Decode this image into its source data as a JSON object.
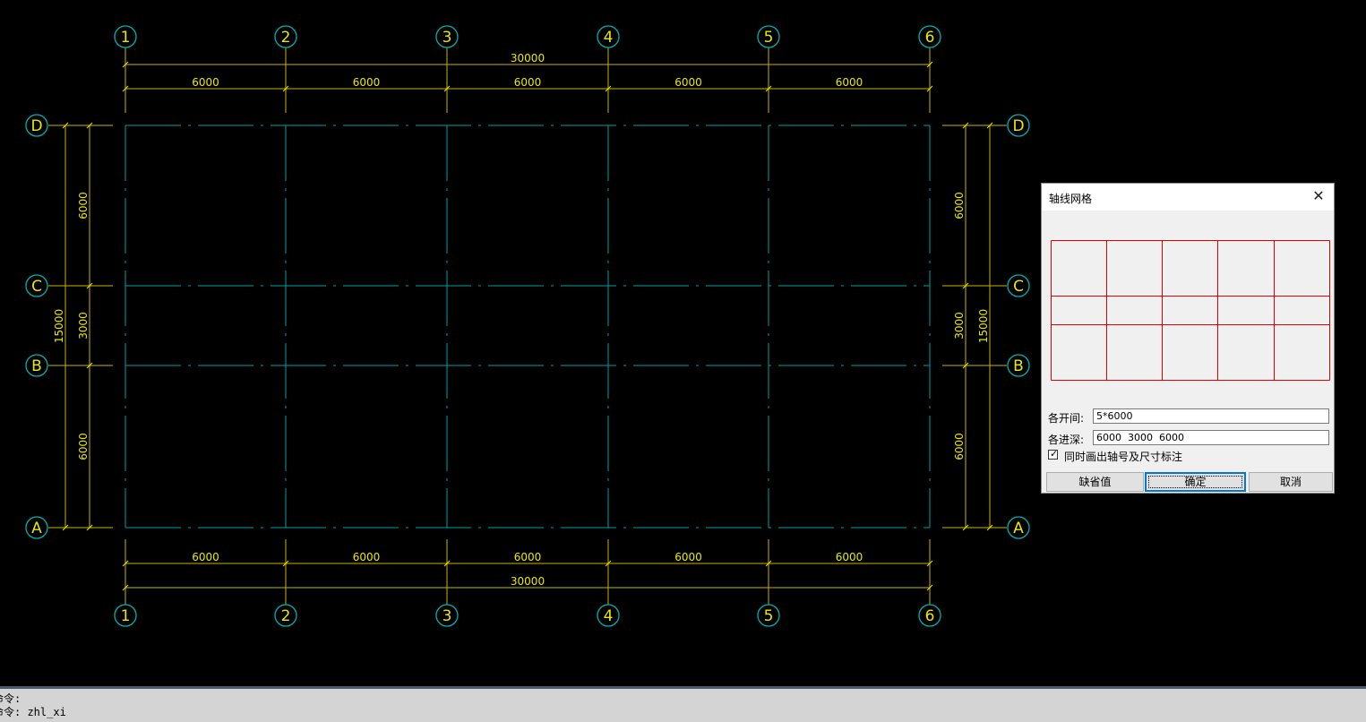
{
  "drawing": {
    "axes_x": [
      "1",
      "2",
      "3",
      "4",
      "5",
      "6"
    ],
    "axes_y": [
      "A",
      "B",
      "C",
      "D"
    ],
    "top_total": "30000",
    "bottom_total": "30000",
    "bay_dims": [
      "6000",
      "6000",
      "6000",
      "6000",
      "6000"
    ],
    "depth_dims": [
      "6000",
      "3000",
      "6000"
    ],
    "depth_total": "15000",
    "colors": {
      "axis_line": "#00a0a0",
      "dim": "#c8b400",
      "dim_text": "#e8e800",
      "bubble_stroke": "#00b0b0",
      "bubble_text": "#e8e800"
    }
  },
  "dialog": {
    "title": "轴线网格",
    "close_glyph": "✕",
    "bays_label": "各开间:",
    "bays_value": "5*6000",
    "depths_label": "各进深:",
    "depths_value": "6000  3000  6000",
    "checkbox_label": "同时画出轴号及尺寸标注",
    "checkbox_checked": true,
    "check_glyph": "✓",
    "buttons": {
      "default_label": "缺省值",
      "ok_label": "确定",
      "cancel_label": "取消"
    },
    "preview_color": "#e00000"
  },
  "command": {
    "line1": "命令:",
    "line2": "命令: zhl_xi"
  }
}
